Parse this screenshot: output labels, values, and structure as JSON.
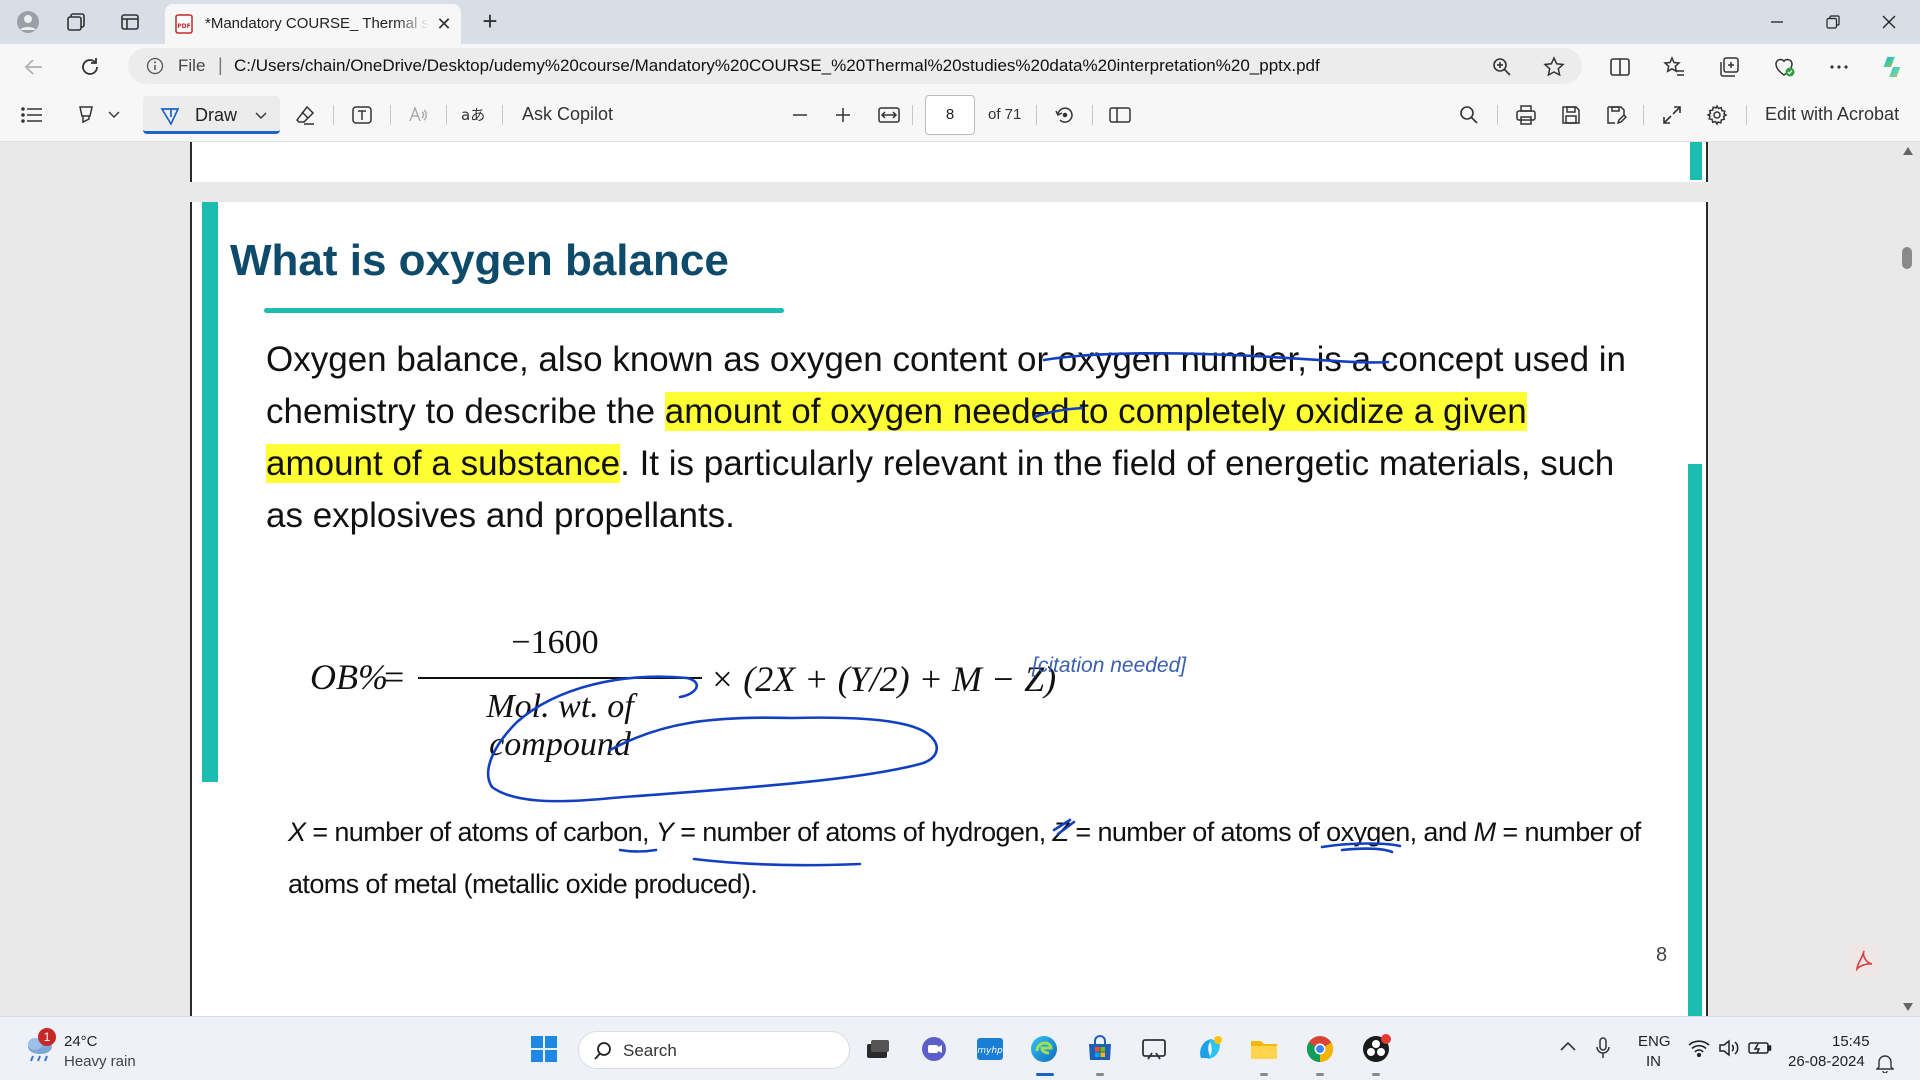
{
  "browser": {
    "tab_title": "*Mandatory COURSE_ Thermal studies data interpretation _pptx.pdf",
    "address_file_label": "File",
    "url": "C:/Users/chain/OneDrive/Desktop/udemy%20course/Mandatory%20COURSE_%20Thermal%20studies%20data%20interpretation%20_pptx.pdf"
  },
  "pdf_toolbar": {
    "draw_label": "Draw",
    "ask_copilot": "Ask Copilot",
    "page_current": "8",
    "page_total": "of 71",
    "edit_acrobat": "Edit with Acrobat"
  },
  "slide": {
    "heading": "What is oxygen balance",
    "para_1": "Oxygen balance, also known as oxygen content or oxygen number, is a concept used in chemistry to describe the ",
    "para_hl": "amount of oxygen needed to completely oxidize a given amount of a substance",
    "para_2": ". It is particularly relevant in the field of energetic materials, such as explosives and propellants.",
    "formula_lhs": "OB%",
    "formula_eq": "=",
    "formula_num": "−1600",
    "formula_den": "Mol. wt. of compound",
    "formula_rest": "× (2X + (Y/2) + M − Z)",
    "citation": "[citation needed]",
    "defs": {
      "x_var": "X",
      "x_def": " = number of atoms of carbon, ",
      "y_var": "Y",
      "y_def": " = number of atoms of hydrogen, ",
      "z_var": "Z",
      "z_def": " = number of atoms of oxygen, and ",
      "m_var": "M",
      "m_def": " = number of atoms of metal (metallic oxide produced)."
    },
    "page_number": "8"
  },
  "taskbar": {
    "weather_badge": "1",
    "weather_temp": "24°C",
    "weather_desc": "Heavy rain",
    "search_label": "Search",
    "lang_1": "ENG",
    "lang_2": "IN",
    "time": "15:45",
    "date": "26-08-2024"
  },
  "colors": {
    "heading": "#0e4a6a",
    "accent_teal": "#1cbcb0",
    "highlight": "#ffff33",
    "ink": "#1340c0"
  }
}
